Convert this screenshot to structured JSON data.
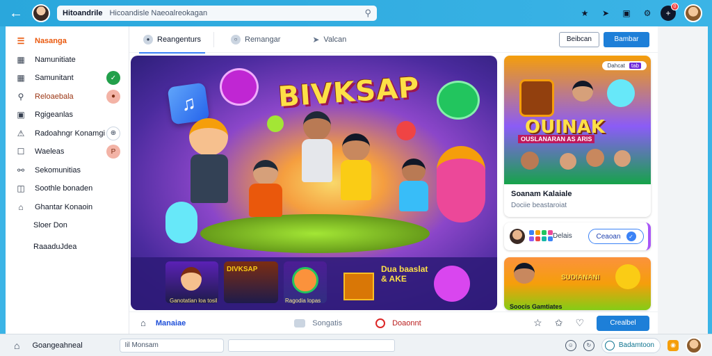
{
  "topbar": {
    "url_domain": "Hitoandrile",
    "url_path": "Hicoandisle Naeoalreokagan",
    "notification_count": "0"
  },
  "sidebar": {
    "items": [
      {
        "label": "Nasanga",
        "icon": "menu-icon"
      },
      {
        "label": "Namunitiate",
        "icon": "list-icon"
      },
      {
        "label": "Samunitant",
        "icon": "grid-icon",
        "pill": "✓"
      },
      {
        "label": "Reloaebala",
        "icon": "search-icon",
        "pill": "●"
      },
      {
        "label": "Rgigeanlas",
        "icon": "image-icon"
      },
      {
        "label": "Radoahngr Konamgi",
        "icon": "bell-icon",
        "pill": "⊕"
      },
      {
        "label": "Waeleas",
        "icon": "square-icon",
        "pill": "P"
      },
      {
        "label": "Sekomunitias",
        "icon": "group-icon"
      },
      {
        "label": "Soothle bonaden",
        "icon": "book-icon"
      },
      {
        "label": "Ghantar Konaoin",
        "icon": "home-icon"
      },
      {
        "label": "Sloer Don",
        "icon": ""
      },
      {
        "label": "RaaaduJdea",
        "icon": ""
      }
    ]
  },
  "tabs": [
    {
      "label": "Reangenturs"
    },
    {
      "label": "Remangar"
    },
    {
      "label": "Valcan"
    }
  ],
  "header_buttons": {
    "secondary": "Beibcan",
    "primary": "Bambar"
  },
  "hero": {
    "title": "BIVKSAP",
    "thumbs": [
      "Ganotatian loa tosil",
      "Ragodia lopas"
    ],
    "strip_text": "Dua baaslat\n& AKE"
  },
  "card1": {
    "art_title": "OUINAK",
    "art_sub": "OUSLANARAN AS ARIS",
    "chip_text": "Dahcat",
    "chip_tag": "tab",
    "caption_title": "Soanam Kalaiale",
    "caption_sub": "Dociie beastaroiat"
  },
  "card2": {
    "label": "Delais",
    "button": "Ceaoan"
  },
  "card3": {
    "art_title": "SUDIANANI",
    "caption": "Soocis Gamtiates"
  },
  "main_footer": {
    "label": "Manaiae",
    "item1": "Songatis",
    "item2": "Doaonnt",
    "button": "Crealbel"
  },
  "bottombar": {
    "title": "Goangeahneal",
    "field": "Iil Monsam",
    "pill": "Badamtoon"
  },
  "colors": {
    "accent": "#1d7fd8",
    "topbar": "#2aa7dc",
    "active_sidebar": "#ea580c"
  }
}
